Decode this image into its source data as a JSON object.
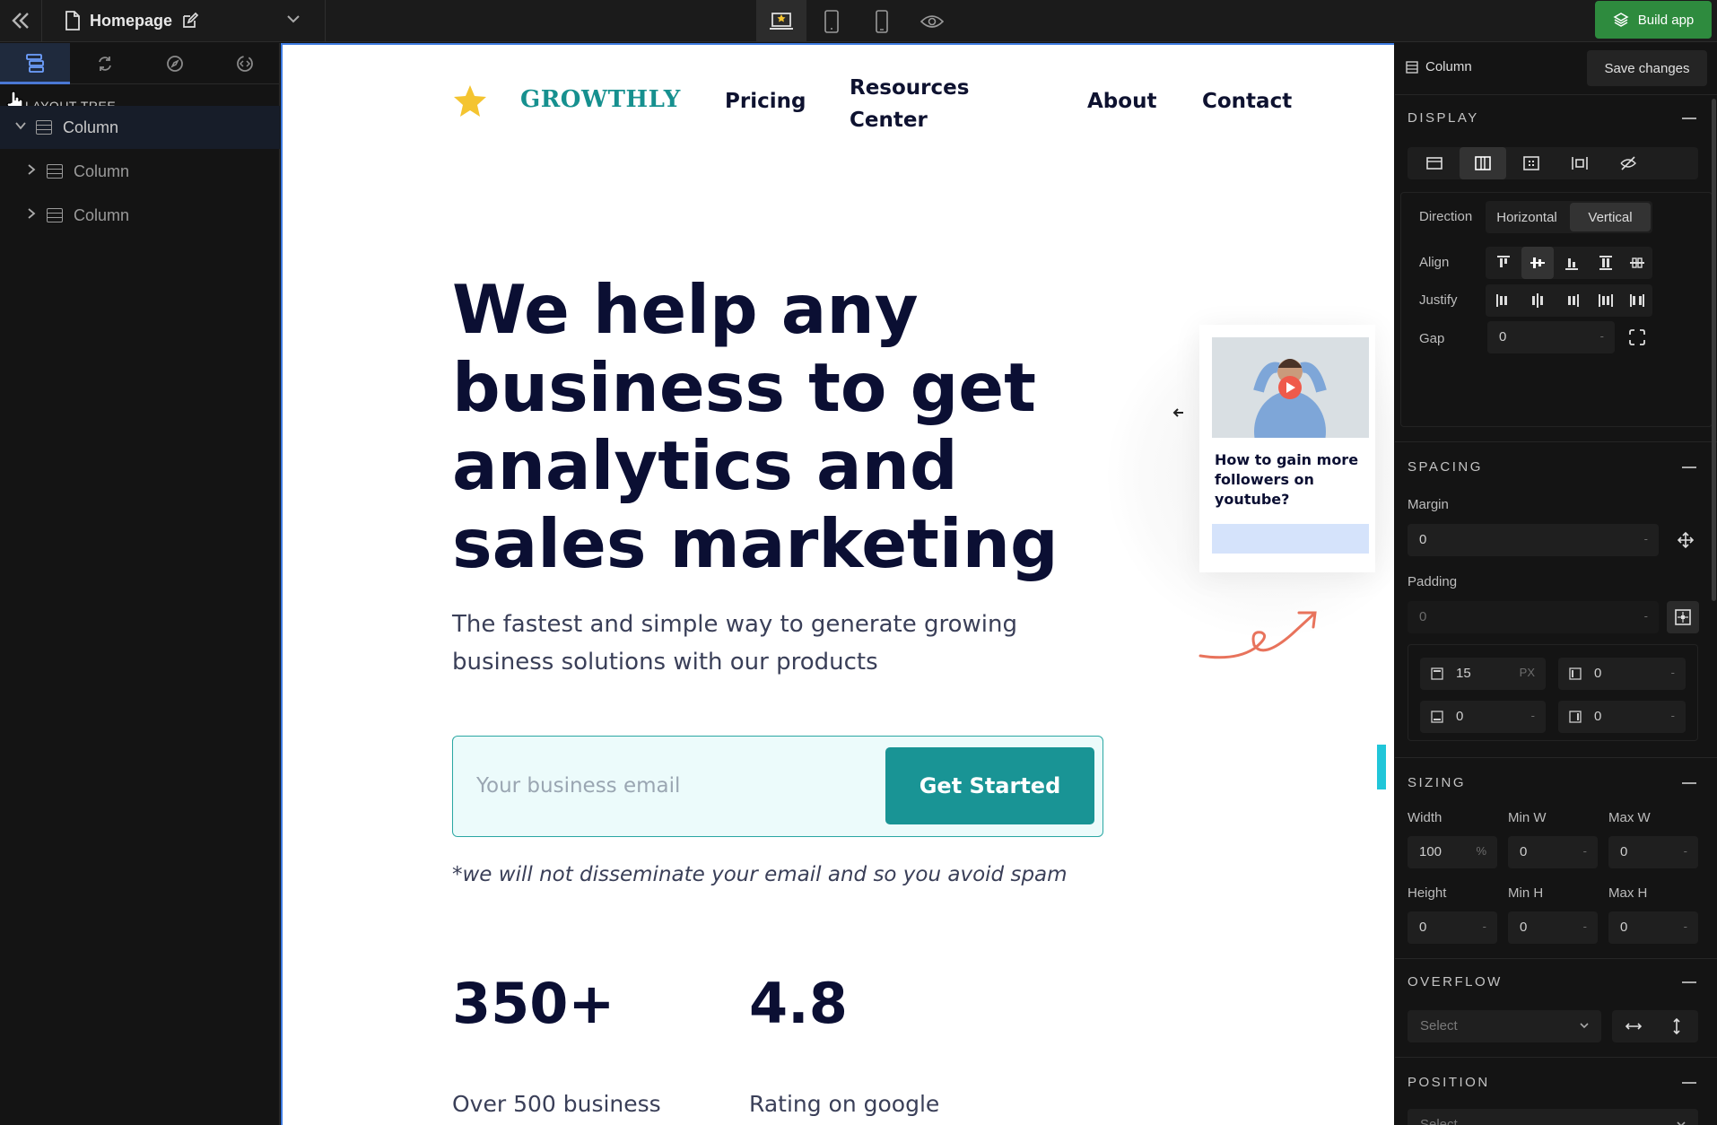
{
  "topbar": {
    "page_name": "Homepage",
    "build_label": "Build app"
  },
  "left_panel": {
    "tree_title": "LAYOUT TREE",
    "items": [
      {
        "label": "Column"
      },
      {
        "label": "Column"
      },
      {
        "label": "Column"
      }
    ]
  },
  "site": {
    "logo": "GROWTHLY",
    "nav": {
      "pricing": "Pricing",
      "resources_1": "Resources",
      "resources_2": "Center",
      "about": "About",
      "contact": "Contact"
    },
    "hero_title": "We help any business to get analytics and sales marketing",
    "hero_sub": "The fastest and simple way to generate growing business solutions with our products",
    "email_placeholder": "Your business email",
    "cta": "Get Started",
    "spam_note": "*we will not disseminate your email and so you avoid spam",
    "stats": [
      {
        "value": "350+",
        "label": "Over 500 business"
      },
      {
        "value": "4.8",
        "label": "Rating on google"
      }
    ],
    "card_title": "How to gain more followers on youtube?"
  },
  "right_panel": {
    "element": "Column",
    "save_label": "Save changes",
    "display": {
      "heading": "DISPLAY",
      "direction_label": "Direction",
      "direction_options": [
        "Horizontal",
        "Vertical"
      ],
      "direction_selected": "Vertical",
      "align_label": "Align",
      "justify_label": "Justify",
      "gap_label": "Gap",
      "gap_value": "0",
      "dash": "-"
    },
    "spacing": {
      "heading": "SPACING",
      "margin_label": "Margin",
      "margin_value": "0",
      "padding_label": "Padding",
      "padding_value": "0",
      "padding_top": "15",
      "padding_top_unit": "PX",
      "padding_left": "0",
      "padding_bottom": "0",
      "padding_right": "0"
    },
    "sizing": {
      "heading": "SIZING",
      "width_label": "Width",
      "width_value": "100",
      "width_unit": "%",
      "minw_label": "Min W",
      "minw_value": "0",
      "maxw_label": "Max W",
      "maxw_value": "0",
      "height_label": "Height",
      "height_value": "0",
      "minh_label": "Min H",
      "minh_value": "0",
      "maxh_label": "Max H",
      "maxh_value": "0"
    },
    "overflow": {
      "heading": "OVERFLOW",
      "select_placeholder": "Select"
    },
    "position": {
      "heading": "POSITION",
      "select_placeholder": "Select"
    }
  },
  "colors": {
    "accent": "#199495",
    "build_green": "#2e8b3e",
    "selection_blue": "#3d7be0",
    "hero_text": "#0b0f33"
  }
}
